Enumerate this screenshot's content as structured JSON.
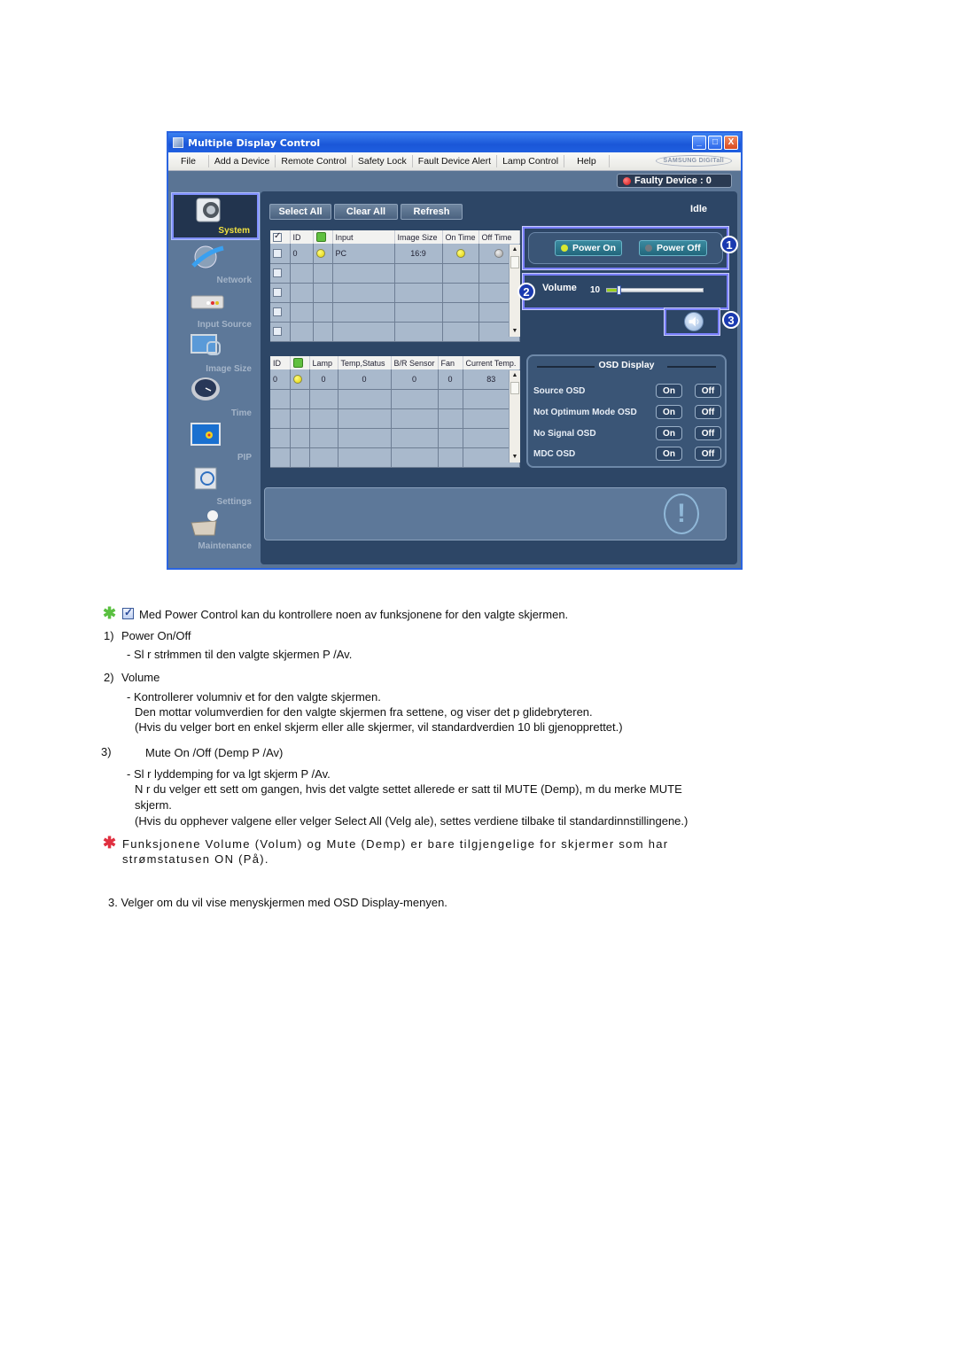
{
  "window": {
    "title": "Multiple Display Control",
    "controls": {
      "minimize": "_",
      "maximize": "□",
      "close": "X"
    },
    "menu": [
      "File",
      "Add a Device",
      "Remote Control",
      "Safety Lock",
      "Fault Device Alert",
      "Lamp Control",
      "Help"
    ],
    "brand": "SAMSUNG DIGITall",
    "faulty_device": "Faulty Device : 0"
  },
  "sidebar": {
    "items": [
      {
        "label": "System",
        "icon": "system-icon",
        "active": true
      },
      {
        "label": "Network",
        "icon": "network-icon"
      },
      {
        "label": "Input Source",
        "icon": "input-source-icon"
      },
      {
        "label": "Image Size",
        "icon": "image-size-icon"
      },
      {
        "label": "Time",
        "icon": "clock-icon"
      },
      {
        "label": "PIP",
        "icon": "pip-icon"
      },
      {
        "label": "Settings",
        "icon": "settings-icon"
      },
      {
        "label": "Maintenance",
        "icon": "maintenance-icon"
      }
    ]
  },
  "toolbar": {
    "select_all": "Select All",
    "clear_all": "Clear All",
    "refresh": "Refresh",
    "status": "Idle"
  },
  "device_table": {
    "headers": [
      "",
      "ID",
      "",
      "Input",
      "Image  Size",
      "On Time",
      "Off Time"
    ],
    "rows": [
      {
        "id": "0",
        "power": "on",
        "input": "PC",
        "image_size": "16:9",
        "on_time": "on",
        "off_time": "off"
      },
      {},
      {},
      {},
      {}
    ]
  },
  "status_table": {
    "headers": [
      "ID",
      "",
      "Lamp",
      "Temp,Status",
      "B/R Sensor",
      "Fan",
      "Current Temp."
    ],
    "rows": [
      {
        "id": "0",
        "power": "on",
        "lamp": "0",
        "temp_status": "0",
        "br_sensor": "0",
        "fan": "0",
        "current_temp": "83"
      },
      {},
      {},
      {},
      {}
    ]
  },
  "power": {
    "badge": "1",
    "on_label": "Power On",
    "off_label": "Power Off"
  },
  "volume": {
    "badge": "2",
    "label": "Volume",
    "value": "10",
    "level_fraction": 0.1
  },
  "mute": {
    "badge": "3"
  },
  "osd": {
    "title": "OSD Display",
    "rows": [
      {
        "label": "Source OSD",
        "on": "On",
        "off": "Off"
      },
      {
        "label": "Not Optimum Mode OSD",
        "on": "On",
        "off": "Off"
      },
      {
        "label": "No Signal OSD",
        "on": "On",
        "off": "Off"
      },
      {
        "label": "MDC OSD",
        "on": "On",
        "off": "Off"
      }
    ]
  },
  "doc": {
    "intro": "Med Power Control kan du kontrollere noen av funksjonene for den valgte skjermen.",
    "item1_num": "1)",
    "item1_title": "Power On/Off",
    "item1_desc": "- Sl r strłmmen til den valgte skjermen P /Av.",
    "item2_num": "2)",
    "item2_title": "Volume",
    "item2_desc1": "- Kontrollerer volumniv et for den valgte skjermen.",
    "item2_desc2": "Den mottar volumverdien for den valgte skjermen  fra settene, og viser det p  glidebryteren.",
    "item2_desc3": "(Hvis du velger bort en enkel skjerm eller alle  skjermer, vil standardverdien 10 bli gjenopprettet.)",
    "item3_num": "3)",
    "item3_title": "Mute On /Off (Demp P /Av)",
    "item3_desc1": "- Sl r lyddemping for va lgt skjerm P /Av.",
    "item3_desc2": "N r du velger ett sett om gangen, hvis det valgte settet   allerede er satt til MUTE (Demp), m  du merke MUTE",
    "item3_desc3": "skjerm.",
    "item3_desc4": "(Hvis du opphever valgene eller velger Select All (Velg ale), settes verdiene tilbake til standardinnstillingene.)",
    "note1": "Funksjonene Volume (Volum) og Mute (Demp) er bare tilgjengelige for skjermer som har",
    "note2": "strømstatusen ON (På).",
    "step3": "3.  Velger om du vil vise menyskjermen med OSD Display-menyen."
  }
}
